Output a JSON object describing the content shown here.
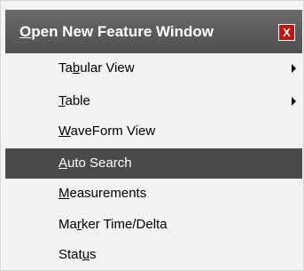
{
  "menu": {
    "title": {
      "pre": "",
      "mnemonic": "O",
      "post": "pen New Feature Window"
    },
    "close_label": "X",
    "items": [
      {
        "pre": "Ta",
        "mnemonic": "b",
        "post": "ular View",
        "has_submenu": true
      },
      {
        "pre": "",
        "mnemonic": "T",
        "post": "able",
        "has_submenu": true
      },
      {
        "pre": "",
        "mnemonic": "W",
        "post": "aveForm View",
        "has_submenu": false
      },
      {
        "pre": "",
        "mnemonic": "A",
        "post": "uto Search",
        "has_submenu": false,
        "highlighted": true
      },
      {
        "pre": "",
        "mnemonic": "M",
        "post": "easurements",
        "has_submenu": false
      },
      {
        "pre": "Ma",
        "mnemonic": "r",
        "post": "ker Time/Delta",
        "has_submenu": false
      },
      {
        "pre": "Stat",
        "mnemonic": "u",
        "post": "s",
        "has_submenu": false
      }
    ]
  },
  "colors": {
    "header_bg": "#5b5b5b",
    "highlight_bg": "#4a4a4a",
    "menu_bg": "#f3f3f3",
    "close_bg": "#c8120f"
  }
}
